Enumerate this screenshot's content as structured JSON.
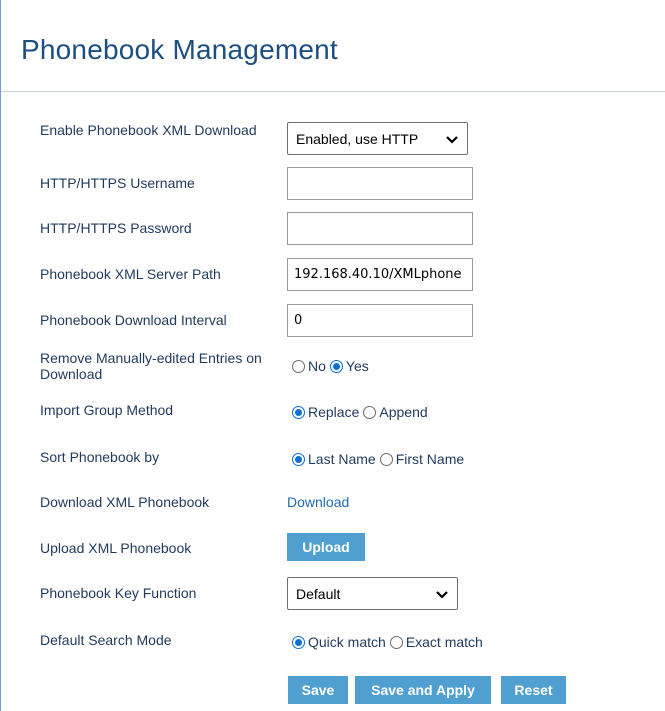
{
  "page": {
    "title": "Phonebook Management"
  },
  "fields": {
    "enable_xml_download": {
      "label": "Enable Phonebook XML Download",
      "value": "Enabled, use HTTP"
    },
    "http_username": {
      "label": "HTTP/HTTPS Username",
      "value": ""
    },
    "http_password": {
      "label": "HTTP/HTTPS Password",
      "value": ""
    },
    "xml_server_path": {
      "label": "Phonebook XML Server Path",
      "value": "192.168.40.10/XMLphone"
    },
    "download_interval": {
      "label": "Phonebook Download Interval",
      "value": "0"
    },
    "remove_manual_entries": {
      "label": "Remove Manually-edited Entries on Download",
      "options": [
        "No",
        "Yes"
      ],
      "selected": "Yes"
    },
    "import_group_method": {
      "label": "Import Group Method",
      "options": [
        "Replace",
        "Append"
      ],
      "selected": "Replace"
    },
    "sort_by": {
      "label": "Sort Phonebook by",
      "options": [
        "Last Name",
        "First Name"
      ],
      "selected": "Last Name"
    },
    "download_xml": {
      "label": "Download XML Phonebook",
      "link": "Download"
    },
    "upload_xml": {
      "label": "Upload XML Phonebook",
      "button": "Upload"
    },
    "key_function": {
      "label": "Phonebook Key Function",
      "value": "Default"
    },
    "search_mode": {
      "label": "Default Search Mode",
      "options": [
        "Quick match",
        "Exact match"
      ],
      "selected": "Quick match"
    }
  },
  "actions": {
    "save": "Save",
    "save_apply": "Save and Apply",
    "reset": "Reset"
  },
  "colors": {
    "accent": "#4f9fd0",
    "title": "#1c4f7f",
    "label": "#1f3a5c",
    "radio": "#0b6fd6",
    "link": "#1f6bb5"
  }
}
